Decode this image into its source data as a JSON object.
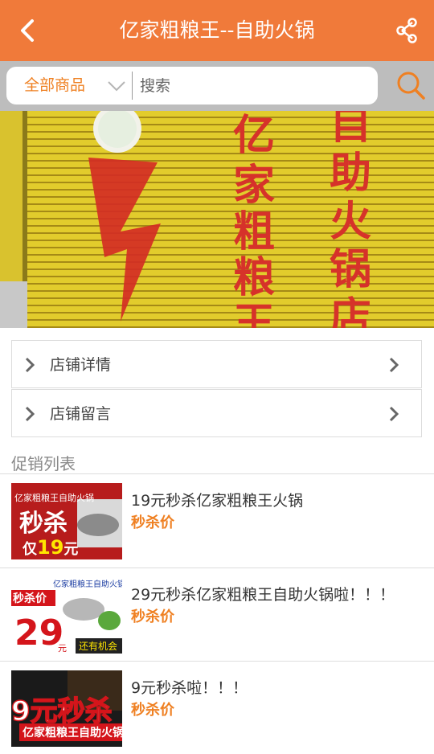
{
  "header": {
    "title": "亿家粗粮王--自助火锅",
    "back_icon": "chevron-left-icon",
    "share_icon": "share-icon",
    "bg_color": "#f07a3a"
  },
  "search": {
    "category": "全部商品",
    "placeholder": "搜索",
    "value": "",
    "search_icon": "search-icon"
  },
  "banner": {
    "alt": "亿家粗粮王自助火锅店 招牌",
    "sign_left": "亿家粗粮王",
    "sign_right": "自助火锅店"
  },
  "menu": [
    {
      "label": "店铺详情"
    },
    {
      "label": "店铺留言"
    }
  ],
  "promo_section": {
    "title": "促销列表"
  },
  "promos": [
    {
      "title": "19元秒杀亿家粗粮王火锅",
      "tag": "秒杀价",
      "thumb_text": "秒杀 仅19元"
    },
    {
      "title": "29元秒杀亿家粗粮王自助火锅啦！！！",
      "tag": "秒杀价",
      "thumb_text": "秒杀价 29元 还有机会"
    },
    {
      "title": "9元秒杀啦！！！",
      "tag": "秒杀价",
      "thumb_text": "9元秒杀"
    }
  ],
  "colors": {
    "accent": "#ef8022",
    "header": "#f07a3a",
    "search_bg": "#bdbdbd"
  }
}
